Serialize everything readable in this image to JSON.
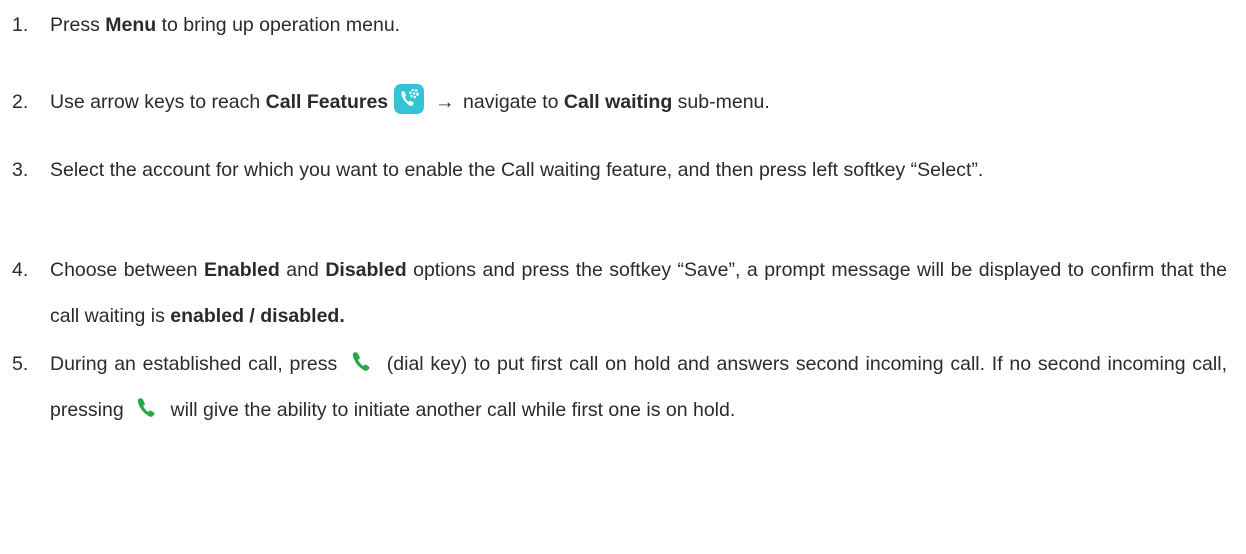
{
  "steps": [
    {
      "number": "1.",
      "parts": [
        "Press ",
        "Menu",
        " to bring up operation menu."
      ]
    },
    {
      "number": "2.",
      "parts": [
        "Use arrow keys to reach ",
        "Call Features",
        "→",
        " navigate to ",
        "Call waiting",
        " sub-menu."
      ],
      "icon": "call-features-icon"
    },
    {
      "number": "3.",
      "text": "Select the account for which you want to enable the Call waiting feature, and then press left softkey “Select”."
    },
    {
      "number": "4.",
      "parts": [
        "Choose between ",
        "Enabled",
        " and ",
        "Disabled",
        " options and press the softkey “Save”, a prompt message will be displayed to confirm that the call waiting is ",
        "enabled / disabled."
      ]
    },
    {
      "number": "5.",
      "parts": [
        "During an established call, press ",
        " (dial key) to put first call on hold and answers second incoming call. If no second incoming call, pressing ",
        " will give the ability to initiate another call while first one is on hold."
      ],
      "icon": "dial-key-icon"
    }
  ],
  "colors": {
    "text": "#2b2b2b",
    "call_features_icon_bg": "#33c3d6",
    "dial_key_icon": "#27a74a"
  }
}
